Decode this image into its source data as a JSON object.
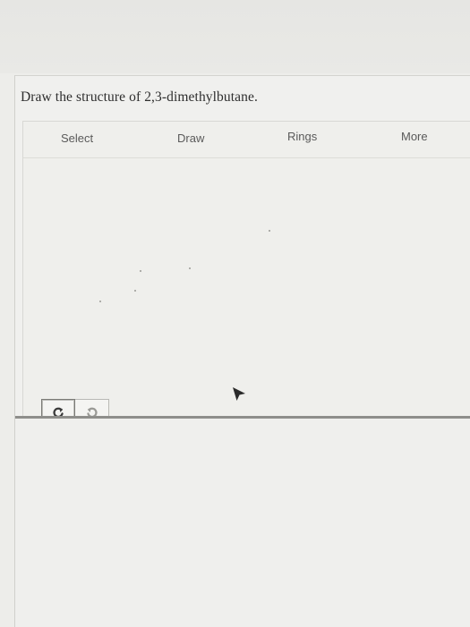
{
  "question": {
    "text": "Draw the structure of 2,3-dimethylbutane."
  },
  "toolbar": {
    "select_label": "Select",
    "draw_label": "Draw",
    "rings_label": "Rings",
    "more_label": "More"
  },
  "history": {
    "undo_icon": "undo-arrow-icon",
    "redo_icon": "redo-arrow-icon"
  },
  "colors": {
    "text": "#2e2e2e",
    "toolbar_text": "#5a5a5a",
    "rule": "#8e8e8b",
    "undo_active": "#3a3a3a",
    "redo_inactive": "#9a9a96"
  }
}
